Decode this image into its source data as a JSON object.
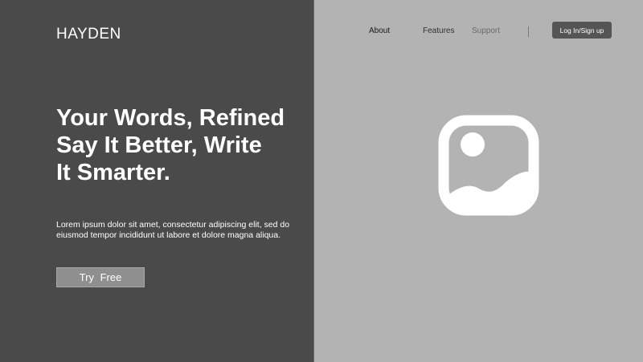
{
  "brand": {
    "name": "HAYDEN"
  },
  "hero": {
    "headline_lines": [
      "Your Words, Refined",
      "Say It Better, Write",
      "It Smarter."
    ],
    "body": "Lorem ipsum dolor sit amet, consectetur adipiscing elit, sed do eiusmod tempor incididunt ut labore et dolore magna aliqua.",
    "cta_label": "Try  Free"
  },
  "nav": {
    "items": [
      {
        "label": "About"
      },
      {
        "label": "Features"
      },
      {
        "label": "Support"
      }
    ],
    "login_label": "Log In/Sign up"
  },
  "media": {
    "icon": "image-placeholder-icon"
  },
  "colors": {
    "left_panel": "#4a4a4a",
    "right_panel": "#b3b3b3",
    "cta_button": "#8f8f8f",
    "login_button": "#555555"
  }
}
